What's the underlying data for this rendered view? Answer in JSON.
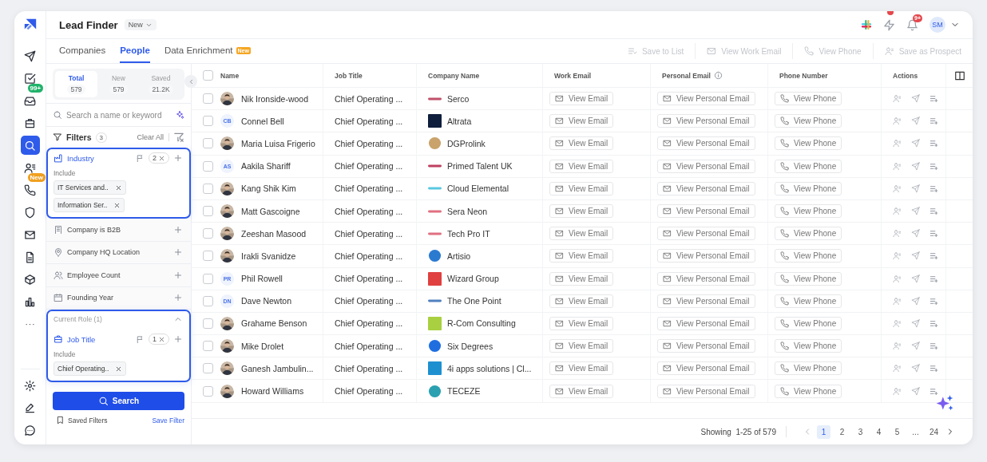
{
  "rail": {
    "top": [
      {
        "selected": false
      },
      {
        "selected": false
      },
      {
        "selected": false,
        "badge": "99+"
      },
      {
        "selected": false
      },
      {
        "selected": true
      },
      {
        "selected": false
      },
      {
        "selected": false,
        "badge": "New"
      },
      {
        "selected": false
      },
      {
        "selected": false
      },
      {
        "selected": false
      },
      {
        "selected": false
      },
      {
        "selected": false
      },
      {
        "selected": false
      }
    ],
    "bottom": [
      {
        "selected": false
      },
      {
        "selected": false
      },
      {
        "selected": false
      }
    ]
  },
  "header": {
    "title": "Lead Finder",
    "view": "New",
    "notifications": "9+",
    "user_initials": "SM"
  },
  "tabs": [
    {
      "label": "Companies",
      "selected": false
    },
    {
      "label": "People",
      "selected": true
    },
    {
      "label": "Data Enrichment",
      "selected": false,
      "badge": "New"
    }
  ],
  "toolbar": [
    {
      "label": "Save to List",
      "disabled": true
    },
    {
      "label": "View Work Email",
      "disabled": true
    },
    {
      "label": "View Phone",
      "disabled": true
    },
    {
      "label": "Save as Prospect",
      "disabled": true
    }
  ],
  "counts": [
    {
      "label": "Total",
      "value": "579",
      "selected": true
    },
    {
      "label": "New",
      "value": "579",
      "selected": false
    },
    {
      "label": "Saved",
      "value": "21.2K",
      "selected": false
    }
  ],
  "search": {
    "placeholder": "Search a name or keyword"
  },
  "filters_header": {
    "title": "Filters",
    "count": "3",
    "clear": "Clear All"
  },
  "filters": [
    {
      "kind": "card",
      "label": "Industry",
      "active": true,
      "count": "2",
      "include_label": "Include",
      "values": [
        "IT Services and..",
        "Information Ser.."
      ]
    },
    {
      "kind": "row",
      "label": "Company is B2B"
    },
    {
      "kind": "row",
      "label": "Company HQ Location"
    },
    {
      "kind": "row",
      "label": "Employee Count"
    },
    {
      "kind": "row",
      "label": "Founding Year"
    },
    {
      "kind": "group",
      "title": "Current Role (1)",
      "expanded": true,
      "active": true,
      "card": {
        "label": "Job Title",
        "count": "1",
        "include_label": "Include",
        "values": [
          "Chief Operating.."
        ]
      }
    }
  ],
  "search_button": "Search",
  "saved_filters": "Saved Filters",
  "save_filter": "Save Filter",
  "table": {
    "columns": [
      "Name",
      "Job Title",
      "Company Name",
      "Work Email",
      "Personal Email",
      "Phone Number",
      "Actions"
    ],
    "header_checked": false,
    "rows": [
      {
        "checked": false,
        "name": "Nik Ironside-wood",
        "title": "Chief Operating ...",
        "company": "Serco",
        "logo": {
          "kind": "mark",
          "color": "#c0506a"
        },
        "work_email": "View Email",
        "personal_email": "View Personal Email",
        "phone": "View Phone"
      },
      {
        "checked": false,
        "avatar": {
          "kind": "initials",
          "initials": "CB"
        },
        "name": "Connel Bell",
        "title": "Chief Operating ...",
        "company": "Altrata",
        "logo": {
          "kind": "square",
          "color": "#0f1e3d"
        },
        "work_email": "View Email",
        "personal_email": "View Personal Email",
        "phone": "View Phone"
      },
      {
        "checked": false,
        "name": "Maria Luisa Frigerio",
        "title": "Chief Operating ...",
        "company": "DGProlink",
        "logo": {
          "kind": "round",
          "color": "#c9a36b"
        },
        "work_email": "View Email",
        "personal_email": "View Personal Email",
        "phone": "View Phone"
      },
      {
        "checked": false,
        "avatar": {
          "kind": "initials",
          "initials": "AS"
        },
        "name": "Aakila Shariff",
        "title": "Chief Operating ...",
        "company": "Primed Talent UK",
        "logo": {
          "kind": "mark",
          "color": "#c04060"
        },
        "work_email": "View Email",
        "personal_email": "View Personal Email",
        "phone": "View Phone"
      },
      {
        "checked": false,
        "name": "Kang Shik Kim",
        "title": "Chief Operating ...",
        "company": "Cloud Elemental",
        "logo": {
          "kind": "mark",
          "color": "#5ac8e0"
        },
        "work_email": "View Email",
        "personal_email": "View Personal Email",
        "phone": "View Phone"
      },
      {
        "checked": false,
        "name": "Matt Gascoigne",
        "title": "Chief Operating ...",
        "company": "Sera Neon",
        "logo": {
          "kind": "mark",
          "color": "#e07080"
        },
        "work_email": "View Email",
        "personal_email": "View Personal Email",
        "phone": "View Phone"
      },
      {
        "checked": false,
        "name": "Zeeshan Masood",
        "title": "Chief Operating ...",
        "company": "Tech Pro IT",
        "logo": {
          "kind": "mark",
          "color": "#e07081"
        },
        "work_email": "View Email",
        "personal_email": "View Personal Email",
        "phone": "View Phone"
      },
      {
        "checked": false,
        "name": "Irakli Svanidze",
        "title": "Chief Operating ...",
        "company": "Artisio",
        "logo": {
          "kind": "round",
          "color": "#2a7ad0"
        },
        "work_email": "View Email",
        "personal_email": "View Personal Email",
        "phone": "View Phone"
      },
      {
        "checked": false,
        "avatar": {
          "kind": "initials",
          "initials": "PR"
        },
        "name": "Phil Rowell",
        "title": "Chief Operating ...",
        "company": "Wizard Group",
        "logo": {
          "kind": "square",
          "color": "#e04040"
        },
        "work_email": "View Email",
        "personal_email": "View Personal Email",
        "phone": "View Phone"
      },
      {
        "checked": false,
        "avatar": {
          "kind": "initials",
          "initials": "DN"
        },
        "name": "Dave Newton",
        "title": "Chief Operating ...",
        "company": "The One Point",
        "logo": {
          "kind": "mark",
          "color": "#5080c0"
        },
        "work_email": "View Email",
        "personal_email": "View Personal Email",
        "phone": "View Phone"
      },
      {
        "checked": false,
        "name": "Grahame Benson",
        "title": "Chief Operating ...",
        "company": "R-Com Consulting",
        "logo": {
          "kind": "square",
          "color": "#a8d040"
        },
        "work_email": "View Email",
        "personal_email": "View Personal Email",
        "phone": "View Phone"
      },
      {
        "checked": false,
        "name": "Mike Drolet",
        "title": "Chief Operating ...",
        "company": "Six Degrees",
        "logo": {
          "kind": "round",
          "color": "#1e6ee0"
        },
        "work_email": "View Email",
        "personal_email": "View Personal Email",
        "phone": "View Phone"
      },
      {
        "checked": false,
        "name": "Ganesh Jambulin...",
        "title": "Chief Operating ...",
        "company": "4i apps solutions | Cl...",
        "logo": {
          "kind": "square",
          "color": "#1e90d0"
        },
        "work_email": "View Email",
        "personal_email": "View Personal Email",
        "phone": "View Phone"
      },
      {
        "checked": false,
        "name": "Howard Williams",
        "title": "Chief Operating ...",
        "company": "TECEZE",
        "logo": {
          "kind": "round",
          "color": "#2aa0b0"
        },
        "work_email": "View Email",
        "personal_email": "View Personal Email",
        "phone": "View Phone"
      }
    ]
  },
  "pagination": {
    "summary": "Showing  1-25 of 579",
    "pages": [
      {
        "label": "1",
        "selected": true
      },
      {
        "label": "2",
        "selected": false
      },
      {
        "label": "3",
        "selected": false
      },
      {
        "label": "4",
        "selected": false
      },
      {
        "label": "5",
        "selected": false
      },
      {
        "label": "...",
        "selected": false
      },
      {
        "label": "24",
        "selected": false
      }
    ]
  }
}
